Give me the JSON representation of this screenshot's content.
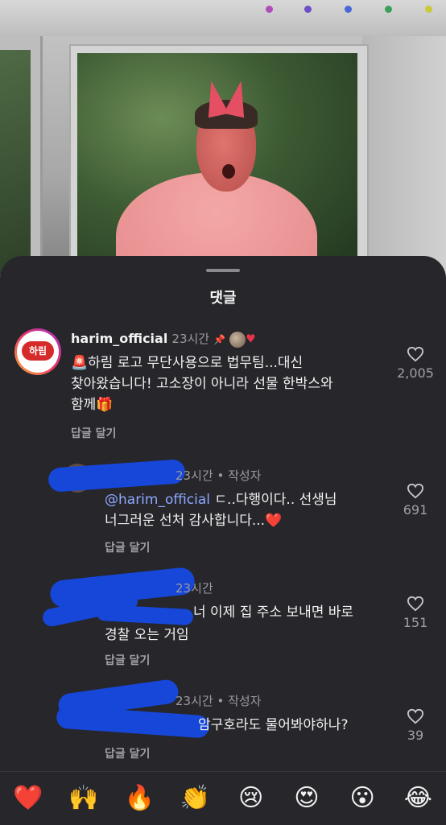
{
  "sheet": {
    "title": "댓글"
  },
  "comments": [
    {
      "username": "harim_official",
      "time": "23시간",
      "avatar_text": "하림",
      "text_line1": "🚨하림 로고 무단사용으로 법무팀...대신",
      "text_line2": "찾아왔습니다! 고소장이 아니라 선물 한박스와",
      "text_line3": "함께🎁",
      "reply_label": "답글 달기",
      "likes": "2,005"
    },
    {
      "time": "23시간 • 작성자",
      "mention": "@harim_official",
      "text_line1": " ㄷ..다행이다.. 선생님",
      "text_line2": "너그러운 선처 감사합니다...❤️",
      "reply_label": "답글 달기",
      "likes": "691"
    },
    {
      "time": "23시간",
      "text_line1": "너 이제 집 주소 보내면 바로",
      "text_line2": "경찰 오는 거임",
      "reply_label": "답글 달기",
      "likes": "151"
    },
    {
      "time": "23시간 • 작성자",
      "text_line1": "암구호라도 물어봐야하나?",
      "reply_label": "답글 달기",
      "likes": "39"
    }
  ],
  "emoji_bar": [
    "❤️",
    "🙌",
    "🔥",
    "👏",
    "😢",
    "😍",
    "😮",
    "😂"
  ],
  "colors": {
    "sheet_bg": "#26262b",
    "mention": "#8fa8ff",
    "redaction": "#1747d9",
    "heart": "#e8344b"
  }
}
